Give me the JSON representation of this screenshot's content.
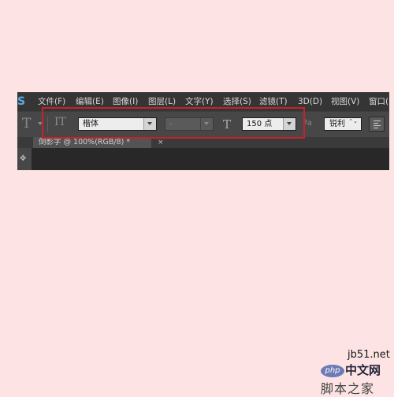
{
  "menubar": {
    "logo": "S",
    "items": [
      "文件(F)",
      "编辑(E)",
      "图像(I)",
      "图层(L)",
      "文字(Y)",
      "选择(S)",
      "滤镜(T)",
      "3D(D)",
      "视图(V)",
      "窗口("
    ]
  },
  "options": {
    "tool_icon": "T",
    "orientation_icon": "IT",
    "font_family": "楷体",
    "font_style": "-",
    "size_icon": "T",
    "font_size": "150 点",
    "aa_icon": "ªa",
    "antialias": "锐利",
    "spin": "⌃⌄"
  },
  "document": {
    "tab_title": "倒影字 @ 100%(RGB/8)",
    "tab_suffix": "*",
    "close": "×"
  },
  "tools": {
    "grip": "✥"
  },
  "watermark": {
    "logo": "php",
    "site": "jb51.net",
    "cn": "中文网",
    "bottom": "脚本之家"
  },
  "colors": {
    "highlight": "#c8212a",
    "background": "#fde3e3"
  }
}
